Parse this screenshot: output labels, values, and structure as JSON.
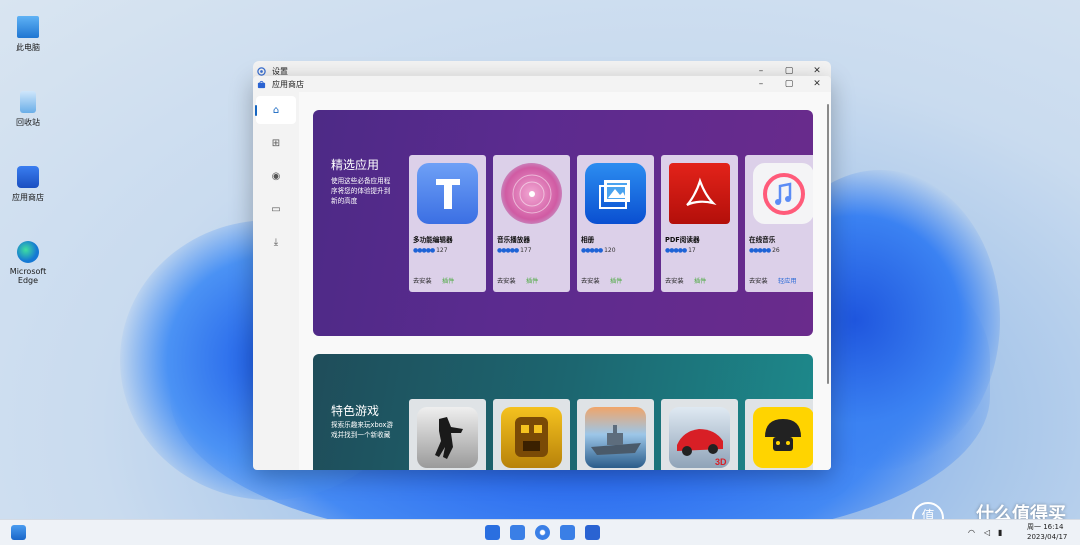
{
  "desktop": {
    "icons": [
      {
        "label": "此电脑",
        "icon": "computer-icon"
      },
      {
        "label": "回收站",
        "icon": "recycle-bin-icon"
      },
      {
        "label": "应用商店",
        "icon": "store-icon"
      },
      {
        "label": "Microsoft Edge",
        "icon": "edge-icon"
      }
    ]
  },
  "settings_window": {
    "title": "设置",
    "controls": [
      "–",
      "▢",
      "✕"
    ]
  },
  "store_window": {
    "title": "应用商店",
    "controls": [
      "–",
      "▢",
      "✕"
    ],
    "nav": [
      {
        "icon": "home-icon",
        "glyph": "⌂"
      },
      {
        "icon": "grid-icon",
        "glyph": "⊞"
      },
      {
        "icon": "gamepad-icon",
        "glyph": "◉"
      },
      {
        "icon": "folder-icon",
        "glyph": "▭"
      },
      {
        "icon": "download-icon",
        "glyph": "⤓"
      }
    ],
    "featured": {
      "title": "精选应用",
      "desc": "使用这些必备应用程序将您的体验提升到新的高度",
      "apps": [
        {
          "name": "多功能编辑器",
          "rating": "127",
          "install": "去安装",
          "tag": "插件",
          "tag_color": "green"
        },
        {
          "name": "音乐播放器",
          "rating": "177",
          "install": "去安装",
          "tag": "插件",
          "tag_color": "green"
        },
        {
          "name": "相册",
          "rating": "120",
          "install": "去安装",
          "tag": "插件",
          "tag_color": "green"
        },
        {
          "name": "PDF阅读器",
          "rating": "17",
          "install": "去安装",
          "tag": "插件",
          "tag_color": "green"
        },
        {
          "name": "在线音乐",
          "rating": "26",
          "install": "去安装",
          "tag": "轻应用",
          "tag_color": "blue"
        }
      ],
      "stars": "●●●●●"
    },
    "games": {
      "title": "特色游戏",
      "desc": "探索乐趣来玩xbox游戏并找到一个新收藏"
    }
  },
  "taskbar": {
    "datetime_line1": "周一 16:14",
    "datetime_line2": "2023/04/17"
  },
  "watermark": {
    "text": "什么值得买",
    "logo": "值"
  }
}
